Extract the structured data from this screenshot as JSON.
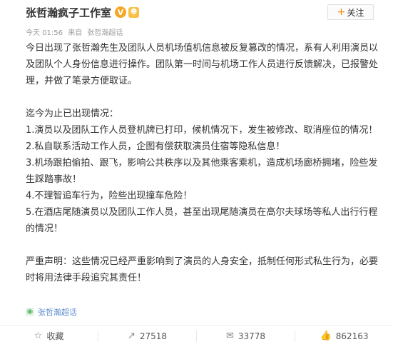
{
  "header": {
    "author_name": "张哲瀚疯子工作室",
    "verified_badge": "V",
    "mini_badge": "☻",
    "follow_label": "关注",
    "timestamp": "今天 01:56",
    "source_prefix": "来自",
    "source_name": "张哲瀚超话"
  },
  "post": {
    "text": "今日出现了张哲瀚先生及团队人员机场值机信息被反复篡改的情况，系有人利用演员以及团队个人身份信息进行操作。团队第一时间与机场工作人员进行反馈解决，已报警处理，并做了笔录方便取证。\n\n迄今为止已出现情况：\n1.演员以及团队工作人员登机牌已打印，候机情况下，发生被修改、取消座位的情况！\n2.私自联系活动工作人员，企图有偿获取演员住宿等隐私信息！\n3.机场跟拍偷拍、跟飞，影响公共秩序以及其他乘客乘机，造成机场廊桥拥堵，险些发生踩踏事故！\n4.不理智追车行为，险些出现撞车危险！\n5.在酒店尾随演员以及团队工作人员，甚至出现尾随演员在高尔夫球场等私人出行行程的情况！\n\n严重声明：这些情况已经严重影响到了演员的人身安全，抵制任何形式私生行为，必要时将用法律手段追究其责任！"
  },
  "topic": {
    "label": "张哲瀚超话"
  },
  "actions": {
    "favorite_label": "收藏",
    "share_count": "27518",
    "comment_count": "33778",
    "like_count": "862163"
  },
  "icons": {
    "favorite": "favorite-icon",
    "share": "share-icon",
    "comment": "comment-icon",
    "like": "like-icon",
    "topic": "topic-icon",
    "verified": "verified-icon"
  },
  "colors": {
    "accent": "#ff8200",
    "link": "#5a8ccf",
    "muted": "#9a9a9a",
    "text": "#333333"
  }
}
